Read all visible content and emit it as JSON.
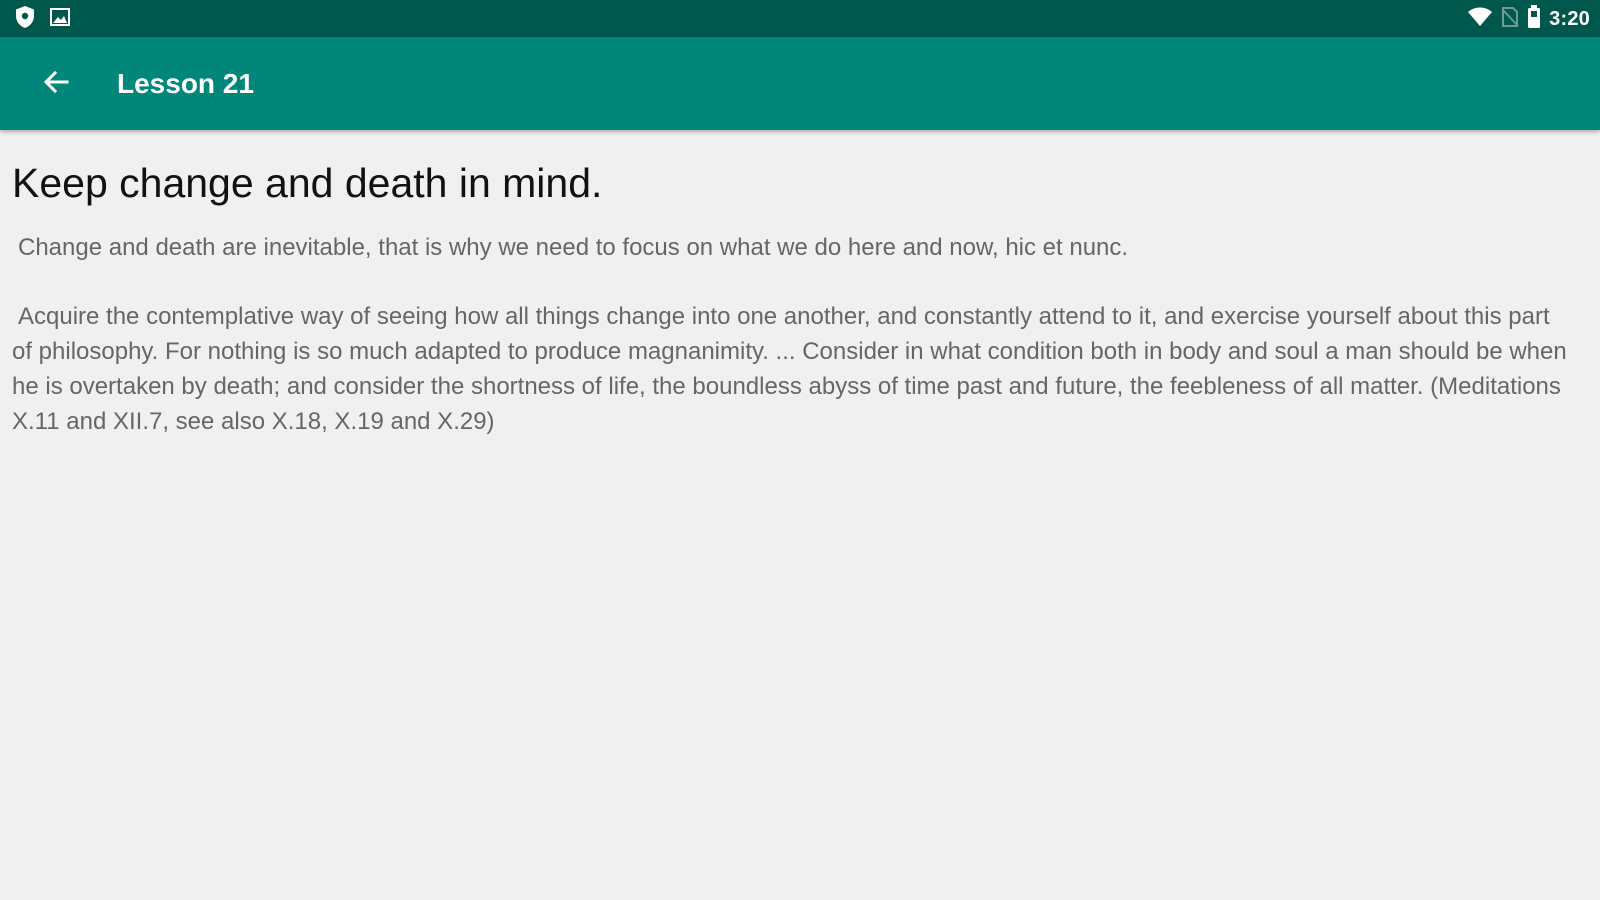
{
  "status_bar": {
    "time": "3:20",
    "left_icons": [
      "shield-icon",
      "image-icon"
    ],
    "right_icons": [
      "wifi-icon",
      "no-sim-icon",
      "battery-icon"
    ],
    "bg_color": "#00574b"
  },
  "app_bar": {
    "back_icon": "arrow-left-icon",
    "title": "Lesson 21",
    "bg_color": "#00877a"
  },
  "lesson": {
    "heading": "Keep change and death in mind.",
    "summary": "Change and death are inevitable, that is why we need to focus on what we do here and now, hic et nunc.",
    "quote": "Acquire the contemplative way of seeing how all things change into one another, and constantly attend to it, and exercise yourself about this part of philosophy. For nothing is so much adapted to produce magnanimity. ... Consider in what condition both in body and soul a man should be when he is overtaken by death; and consider the shortness of life, the boundless abyss of time past and future, the feebleness of all matter. (Meditations X.11 and XII.7, see also X.18, X.19 and X.29)"
  },
  "colors": {
    "page_background": "#f0f0f0",
    "heading_text": "#111111",
    "body_text": "#666666"
  }
}
